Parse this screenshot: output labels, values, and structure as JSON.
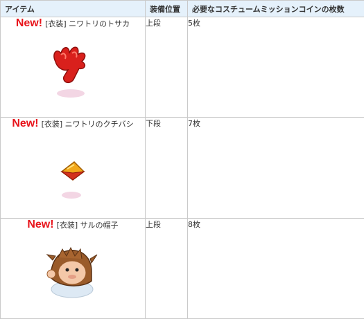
{
  "header": {
    "item": "アイテム",
    "slot": "装備位置",
    "coins": "必要なコスチュームミッションコインの枚数"
  },
  "rows": [
    {
      "badge": "New!",
      "name": "[衣装] ニワトリのトサカ",
      "slot": "上段",
      "coins": "5枚",
      "icon": "rooster-comb-icon",
      "color": "#d9201c"
    },
    {
      "badge": "New!",
      "name": "[衣装] ニワトリのクチバシ",
      "slot": "下段",
      "coins": "7枚",
      "icon": "rooster-beak-icon",
      "color": "#f2a81a"
    },
    {
      "badge": "New!",
      "name": "[衣装] サルの帽子",
      "slot": "上段",
      "coins": "8枚",
      "icon": "monkey-hat-icon",
      "color": "#9a5b2a"
    }
  ]
}
